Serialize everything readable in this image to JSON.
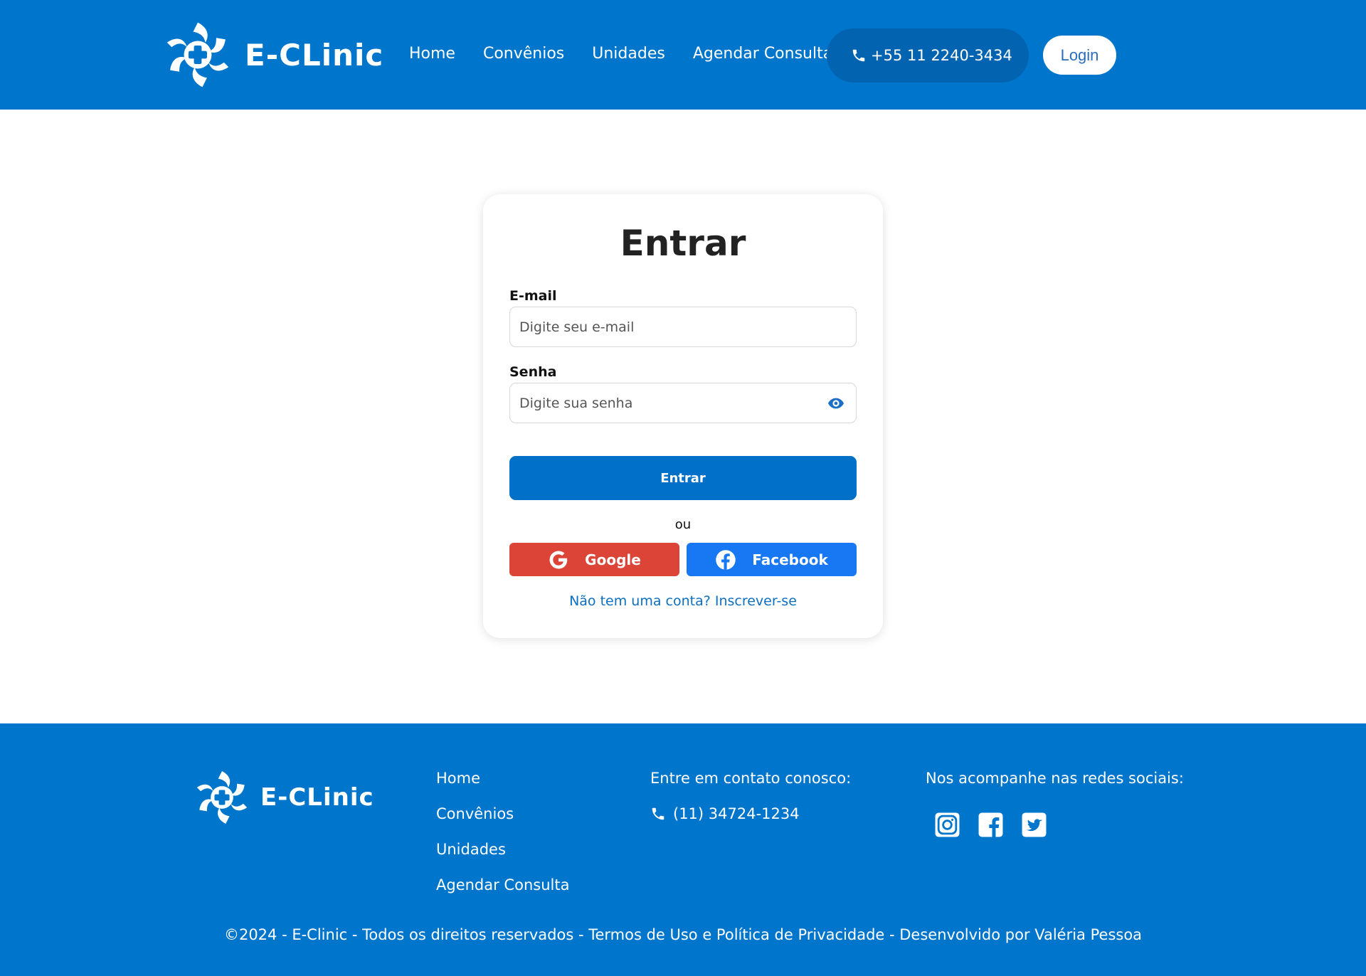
{
  "header": {
    "brand_name": "E-CLinic",
    "nav": [
      "Home",
      "Convênios",
      "Unidades",
      "Agendar Consulta"
    ],
    "phone": "+55 11 2240-3434",
    "login_label": "Login"
  },
  "login": {
    "title": "Entrar",
    "email_label": "E-mail",
    "email_placeholder": "Digite seu e-mail",
    "password_label": "Senha",
    "password_placeholder": "Digite sua senha",
    "submit_label": "Entrar",
    "or_label": "ou",
    "google_label": "Google",
    "facebook_label": "Facebook",
    "signup_link": "Não tem uma conta? Inscrever-se"
  },
  "footer": {
    "brand_name": "E-CLinic",
    "links": [
      "Home",
      "Convênios",
      "Unidades",
      "Agendar Consulta"
    ],
    "contact_title": "Entre em contato conosco:",
    "contact_phone": "(11) 34724-1234",
    "social_title": "Nos acompanhe nas redes sociais:",
    "social_icons": [
      "instagram-icon",
      "facebook-icon",
      "twitter-icon"
    ],
    "copyright": "©2024 - E-Clinic - Todos os direitos reservados - Termos de Uso e Política de Privacidade - Desenvolvido por Valéria Pessoa"
  },
  "colors": {
    "primary": "#0075cc",
    "google": "#db4437",
    "facebook": "#1877f2",
    "link": "#0d6fc1"
  }
}
